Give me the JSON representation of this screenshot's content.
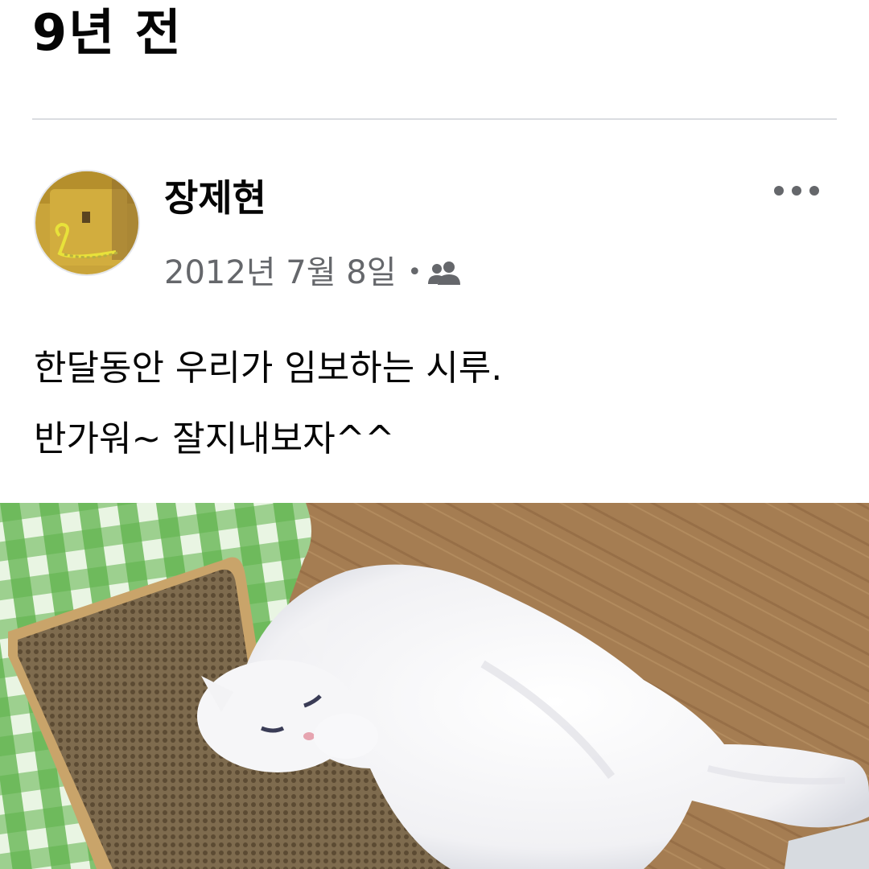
{
  "memory": {
    "title": "9년 전"
  },
  "post": {
    "author": "장제현",
    "date": "2012년 7월 8일",
    "separator": "•",
    "audience_icon": "friends-icon",
    "more_icon": "more-options-icon",
    "text": "한달동안 우리가 임보하는 시루.\n반가워~ 잘지내보자^^",
    "photo_description_icon": "white-cat-photo"
  },
  "colors": {
    "text_primary": "#050505",
    "text_secondary": "#65676b",
    "divider": "#dadde1"
  }
}
